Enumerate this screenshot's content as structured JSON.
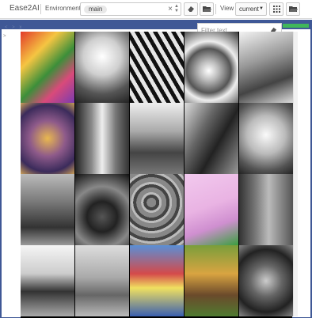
{
  "toolbar": {
    "app_title": "Ease2AI",
    "environment_label": "Environment",
    "environment_value": "main",
    "clear_symbol": "×",
    "view_label": "View",
    "view_value": "current",
    "icons": [
      "eraser-icon",
      "folder-icon",
      "grid-icon",
      "folder-icon"
    ]
  },
  "panel": {
    "controls_text": "< > x",
    "expand_caret": ">",
    "filter": {
      "placeholder": "Filter text",
      "value": ""
    },
    "status_color": "#3fb75a"
  },
  "colors": {
    "band": "#3f5896",
    "background": "#ffffff"
  },
  "gallery": {
    "tiles": [
      {
        "name": "image-tile-food-tray",
        "bg": "linear-gradient(135deg,#e23a2a 0%,#f5c542 30%,#3c8f3a 55%,#d94a7a 75%,#7a3bb0 100%)"
      },
      {
        "name": "image-tile-flower-vase",
        "bg": "radial-gradient(circle at 50% 35%,#ffffff 0%,#cfcfcf 35%,#555 70%,#222 100%)"
      },
      {
        "name": "image-tile-zebra",
        "bg": "repeating-linear-gradient(60deg,#111 0 5px,#e6e6e6 5px 10px)"
      },
      {
        "name": "image-tile-umbrella",
        "bg": "radial-gradient(circle at 45% 55%,#fff 0%,#bbb 20%,#555 45%,#eee 60%,#333 100%)"
      },
      {
        "name": "image-tile-kitchen-rack",
        "bg": "linear-gradient(160deg,#f2f2f2 0%,#999 40%,#444 70%,#ddd 100%)"
      },
      {
        "name": "image-tile-tree-figure",
        "bg": "radial-gradient(circle at 50% 50%,#e9b84f 0%,#8e5a8a 40%,#3b2b5b 75%,#c89d57 100%)"
      },
      {
        "name": "image-tile-clock",
        "bg": "linear-gradient(90deg,#222 0%,#888 30%,#eee 50%,#777 75%,#333 100%)"
      },
      {
        "name": "image-tile-train-station",
        "bg": "linear-gradient(180deg,#eeeeee 0%,#aaaaaa 40%,#444 70%,#777 100%)"
      },
      {
        "name": "image-tile-interior-room",
        "bg": "linear-gradient(120deg,#ddd 0%,#666 35%,#222 60%,#999 100%)"
      },
      {
        "name": "image-tile-hamster",
        "bg": "radial-gradient(circle at 50% 45%,#fafafa 0%,#bbb 40%,#555 75%,#222 100%)"
      },
      {
        "name": "image-tile-living-room",
        "bg": "linear-gradient(180deg,#bbb 0%,#777 40%,#333 75%,#999 100%)"
      },
      {
        "name": "image-tile-stop-sign",
        "bg": "radial-gradient(circle at 50% 60%,#555 0%,#222 30%,#888 60%,#111 100%)"
      },
      {
        "name": "image-tile-rocks",
        "bg": "repeating-radial-gradient(circle at 40% 40%,#888 0 6px,#444 6px 10px,#bbb 10px 13px)"
      },
      {
        "name": "image-tile-skateboarder",
        "bg": "linear-gradient(160deg,#f2c9ee 0%,#e9b3e3 45%,#cf8fd0 70%,#3a9f3f 100%)"
      },
      {
        "name": "image-tile-refrigerator",
        "bg": "linear-gradient(90deg,#333 0%,#777 30%,#bbb 55%,#555 100%)"
      },
      {
        "name": "image-tile-surfer",
        "bg": "linear-gradient(180deg,#f5f5f5 0%,#ccc 40%,#333 65%,#aaa 100%)"
      },
      {
        "name": "image-tile-tennis-player",
        "bg": "linear-gradient(180deg,#ddd 0%,#aaa 45%,#666 70%,#bbb 100%)"
      },
      {
        "name": "image-tile-group-photo",
        "bg": "linear-gradient(180deg,#5a8fd6 0%,#d44a4a 40%,#f0e060 60%,#3a5fb0 100%)"
      },
      {
        "name": "image-tile-giraffe",
        "bg": "linear-gradient(180deg,#7a9e3b 0%,#d9a441 40%,#6b4a2b 70%,#4f7a30 100%)"
      },
      {
        "name": "image-tile-bird-reflection",
        "bg": "radial-gradient(circle at 50% 50%,#ccc 0%,#666 35%,#222 70%,#888 100%)"
      }
    ]
  }
}
